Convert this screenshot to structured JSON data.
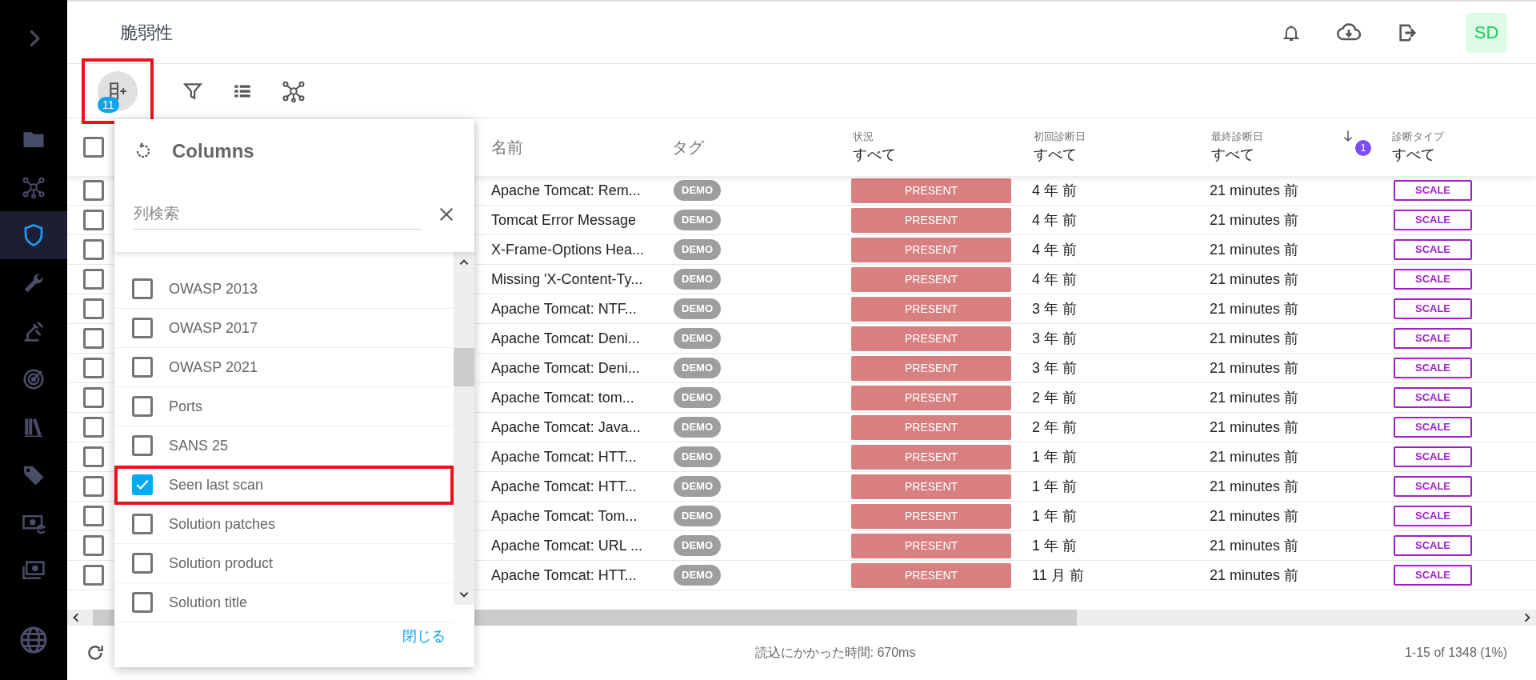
{
  "sidebar": {
    "items": [
      {
        "selected": false
      },
      {
        "selected": false
      },
      {
        "selected": true
      },
      {
        "selected": false
      },
      {
        "selected": false
      },
      {
        "selected": false
      },
      {
        "selected": false
      },
      {
        "selected": false
      },
      {
        "selected": false
      },
      {
        "selected": false
      }
    ]
  },
  "header": {
    "title": "脆弱性",
    "avatar": "SD"
  },
  "toolbar": {
    "columns_button": {
      "badge": "11",
      "highlighted": true
    }
  },
  "columns_panel": {
    "title": "Columns",
    "search": {
      "placeholder": "列検索"
    },
    "close_button": "閉じる",
    "items": [
      {
        "label": "OWASP 2013",
        "checked": false,
        "highlighted": false
      },
      {
        "label": "OWASP 2017",
        "checked": false,
        "highlighted": false
      },
      {
        "label": "OWASP 2021",
        "checked": false,
        "highlighted": false
      },
      {
        "label": "Ports",
        "checked": false,
        "highlighted": false
      },
      {
        "label": "SANS 25",
        "checked": false,
        "highlighted": false
      },
      {
        "label": "Seen last scan",
        "checked": true,
        "highlighted": true
      },
      {
        "label": "Solution patches",
        "checked": false,
        "highlighted": false
      },
      {
        "label": "Solution product",
        "checked": false,
        "highlighted": false
      },
      {
        "label": "Solution title",
        "checked": false,
        "highlighted": false
      }
    ]
  },
  "table": {
    "select_all": {
      "checked": false
    },
    "columns": [
      {
        "label": "名前"
      },
      {
        "label": "タグ"
      },
      {
        "label": "状況",
        "filter": "すべて"
      },
      {
        "label": "初回診断日",
        "filter": "すべて"
      },
      {
        "label": "最終診断日",
        "filter": "すべて",
        "sort_badge": "1"
      },
      {
        "label": "診断タイプ",
        "filter": "すべて"
      }
    ],
    "rows": [
      {
        "name": "Apache Tomcat: Rem...",
        "tag": "DEMO",
        "status": "PRESENT",
        "first_seen": "4 年 前",
        "last_seen": "21 minutes 前",
        "type": "SCALE",
        "checked": false
      },
      {
        "name": "Tomcat Error Message",
        "tag": "DEMO",
        "status": "PRESENT",
        "first_seen": "4 年 前",
        "last_seen": "21 minutes 前",
        "type": "SCALE",
        "checked": false
      },
      {
        "name": "X-Frame-Options Hea...",
        "tag": "DEMO",
        "status": "PRESENT",
        "first_seen": "4 年 前",
        "last_seen": "21 minutes 前",
        "type": "SCALE",
        "checked": false
      },
      {
        "name": "Missing 'X-Content-Ty...",
        "tag": "DEMO",
        "status": "PRESENT",
        "first_seen": "4 年 前",
        "last_seen": "21 minutes 前",
        "type": "SCALE",
        "checked": false
      },
      {
        "name": "Apache Tomcat: NTF...",
        "tag": "DEMO",
        "status": "PRESENT",
        "first_seen": "3 年 前",
        "last_seen": "21 minutes 前",
        "type": "SCALE",
        "checked": false
      },
      {
        "name": "Apache Tomcat: Deni...",
        "tag": "DEMO",
        "status": "PRESENT",
        "first_seen": "3 年 前",
        "last_seen": "21 minutes 前",
        "type": "SCALE",
        "checked": false
      },
      {
        "name": "Apache Tomcat: Deni...",
        "tag": "DEMO",
        "status": "PRESENT",
        "first_seen": "3 年 前",
        "last_seen": "21 minutes 前",
        "type": "SCALE",
        "checked": false
      },
      {
        "name": "Apache Tomcat: tom...",
        "tag": "DEMO",
        "status": "PRESENT",
        "first_seen": "2 年 前",
        "last_seen": "21 minutes 前",
        "type": "SCALE",
        "checked": false
      },
      {
        "name": "Apache Tomcat: Java...",
        "tag": "DEMO",
        "status": "PRESENT",
        "first_seen": "2 年 前",
        "last_seen": "21 minutes 前",
        "type": "SCALE",
        "checked": false
      },
      {
        "name": "Apache Tomcat: HTT...",
        "tag": "DEMO",
        "status": "PRESENT",
        "first_seen": "1 年 前",
        "last_seen": "21 minutes 前",
        "type": "SCALE",
        "checked": false
      },
      {
        "name": "Apache Tomcat: HTT...",
        "tag": "DEMO",
        "status": "PRESENT",
        "first_seen": "1 年 前",
        "last_seen": "21 minutes 前",
        "type": "SCALE",
        "checked": false
      },
      {
        "name": "Apache Tomcat: Tom...",
        "tag": "DEMO",
        "status": "PRESENT",
        "first_seen": "1 年 前",
        "last_seen": "21 minutes 前",
        "type": "SCALE",
        "checked": false
      },
      {
        "name": "Apache Tomcat: URL ...",
        "tag": "DEMO",
        "status": "PRESENT",
        "first_seen": "1 年 前",
        "last_seen": "21 minutes 前",
        "type": "SCALE",
        "checked": false
      },
      {
        "name": "Apache Tomcat: HTT...",
        "tag": "DEMO",
        "status": "PRESENT",
        "first_seen": "11 月 前",
        "last_seen": "21 minutes 前",
        "type": "SCALE",
        "checked": false
      }
    ]
  },
  "footer": {
    "load_time": "読込にかかった時間: 670ms",
    "pagination": "1-15 of 1348 (1%)"
  }
}
